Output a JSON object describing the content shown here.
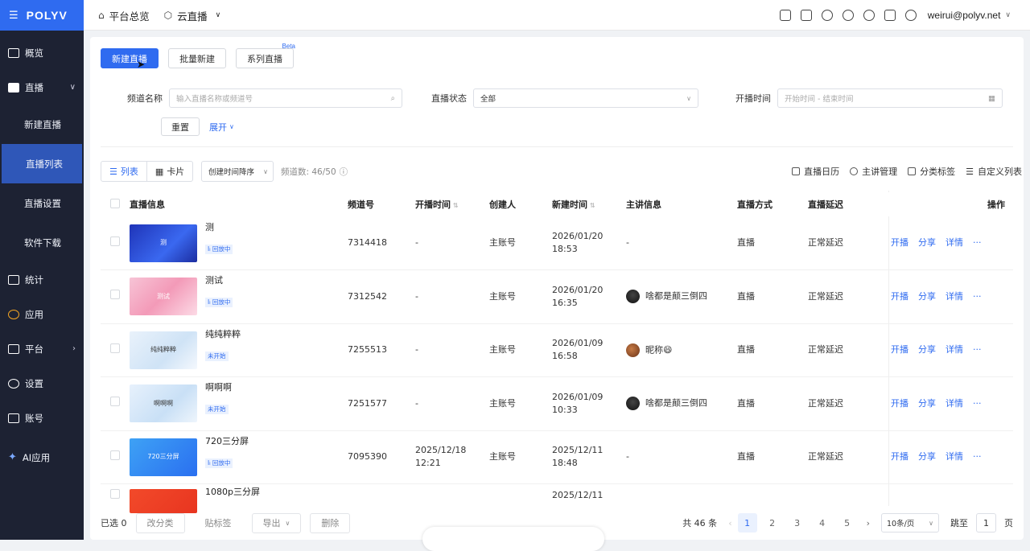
{
  "topbar": {
    "brand": "POLYV",
    "nav": [
      {
        "label": "平台总览",
        "icon": "home-icon"
      },
      {
        "label": "云直播",
        "icon": "cube-icon"
      }
    ],
    "user": "weirui@polyv.net"
  },
  "sidebar": {
    "items": [
      {
        "label": "概览"
      },
      {
        "label": "直播"
      },
      {
        "label": "新建直播"
      },
      {
        "label": "直播列表"
      },
      {
        "label": "直播设置"
      },
      {
        "label": "软件下载"
      },
      {
        "label": "统计"
      },
      {
        "label": "应用"
      },
      {
        "label": "平台"
      },
      {
        "label": "设置"
      },
      {
        "label": "账号"
      },
      {
        "label": "AI应用"
      }
    ]
  },
  "actions": {
    "new": "新建直播",
    "batch": "批量新建",
    "series": "系列直播",
    "beta": "Beta"
  },
  "filters": {
    "name_label": "频道名称",
    "name_placeholder": "输入直播名称或频道号",
    "status_label": "直播状态",
    "status_value": "全部",
    "time_label": "开播时间",
    "time_placeholder": "开始时间 - 结束时间",
    "reset": "重置",
    "expand": "展开"
  },
  "toolbar": {
    "list": "列表",
    "card": "卡片",
    "sort": "创建时间降序",
    "count": "频道数: 46/50",
    "calendar": "直播日历",
    "speaker": "主讲管理",
    "tags": "分类标签",
    "columns": "自定义列表"
  },
  "table": {
    "headers": [
      "直播信息",
      "频道号",
      "开播时间",
      "创建人",
      "新建时间",
      "主讲信息",
      "直播方式",
      "直播延迟",
      "操作"
    ],
    "op_labels": [
      "开播",
      "分享",
      "详情",
      "···"
    ],
    "rows": [
      {
        "title": "测",
        "thumb": "测",
        "tag": "Iₗ 回放中",
        "channel": "7314418",
        "start": "-",
        "creator": "主账号",
        "created": "2026/01/20\n18:53",
        "speaker": "-",
        "mode": "直播",
        "delay": "正常延迟"
      },
      {
        "title": "测试",
        "thumb": "测试",
        "tag": "Iₗ 回放中",
        "channel": "7312542",
        "start": "-",
        "creator": "主账号",
        "created": "2026/01/20\n16:35",
        "speaker": "啥都是颠三倒四",
        "mode": "直播",
        "delay": "正常延迟"
      },
      {
        "title": "纯纯粹粹",
        "thumb": "纯纯粹粹",
        "tag": "未开始",
        "channel": "7255513",
        "start": "-",
        "creator": "主账号",
        "created": "2026/01/09\n16:58",
        "speaker": "昵称😄",
        "mode": "直播",
        "delay": "正常延迟"
      },
      {
        "title": "啊啊啊",
        "thumb": "啊啊啊",
        "tag": "未开始",
        "channel": "7251577",
        "start": "-",
        "creator": "主账号",
        "created": "2026/01/09\n10:33",
        "speaker": "啥都是颠三倒四",
        "mode": "直播",
        "delay": "正常延迟"
      },
      {
        "title": "720三分屏",
        "thumb": "720三分屏",
        "tag": "Iₗ 回放中",
        "channel": "7095390",
        "start": "2025/12/18\n12:21",
        "creator": "主账号",
        "created": "2025/12/11\n18:48",
        "speaker": "-",
        "mode": "直播",
        "delay": "正常延迟"
      },
      {
        "title": "1080p三分屏",
        "thumb": "",
        "tag": "",
        "channel": "",
        "start": "",
        "creator": "",
        "created": "2025/12/11",
        "speaker": "",
        "mode": "",
        "delay": ""
      }
    ]
  },
  "footer": {
    "selected": "已选 0",
    "classify": "改分类",
    "tag": "贴标签",
    "export": "导出",
    "delete": "删除",
    "total": "共 46 条",
    "pages": [
      "1",
      "2",
      "3",
      "4",
      "5"
    ],
    "page_size": "10条/页",
    "jump_label": "跳至",
    "jump_value": "1",
    "page_unit": "页"
  }
}
